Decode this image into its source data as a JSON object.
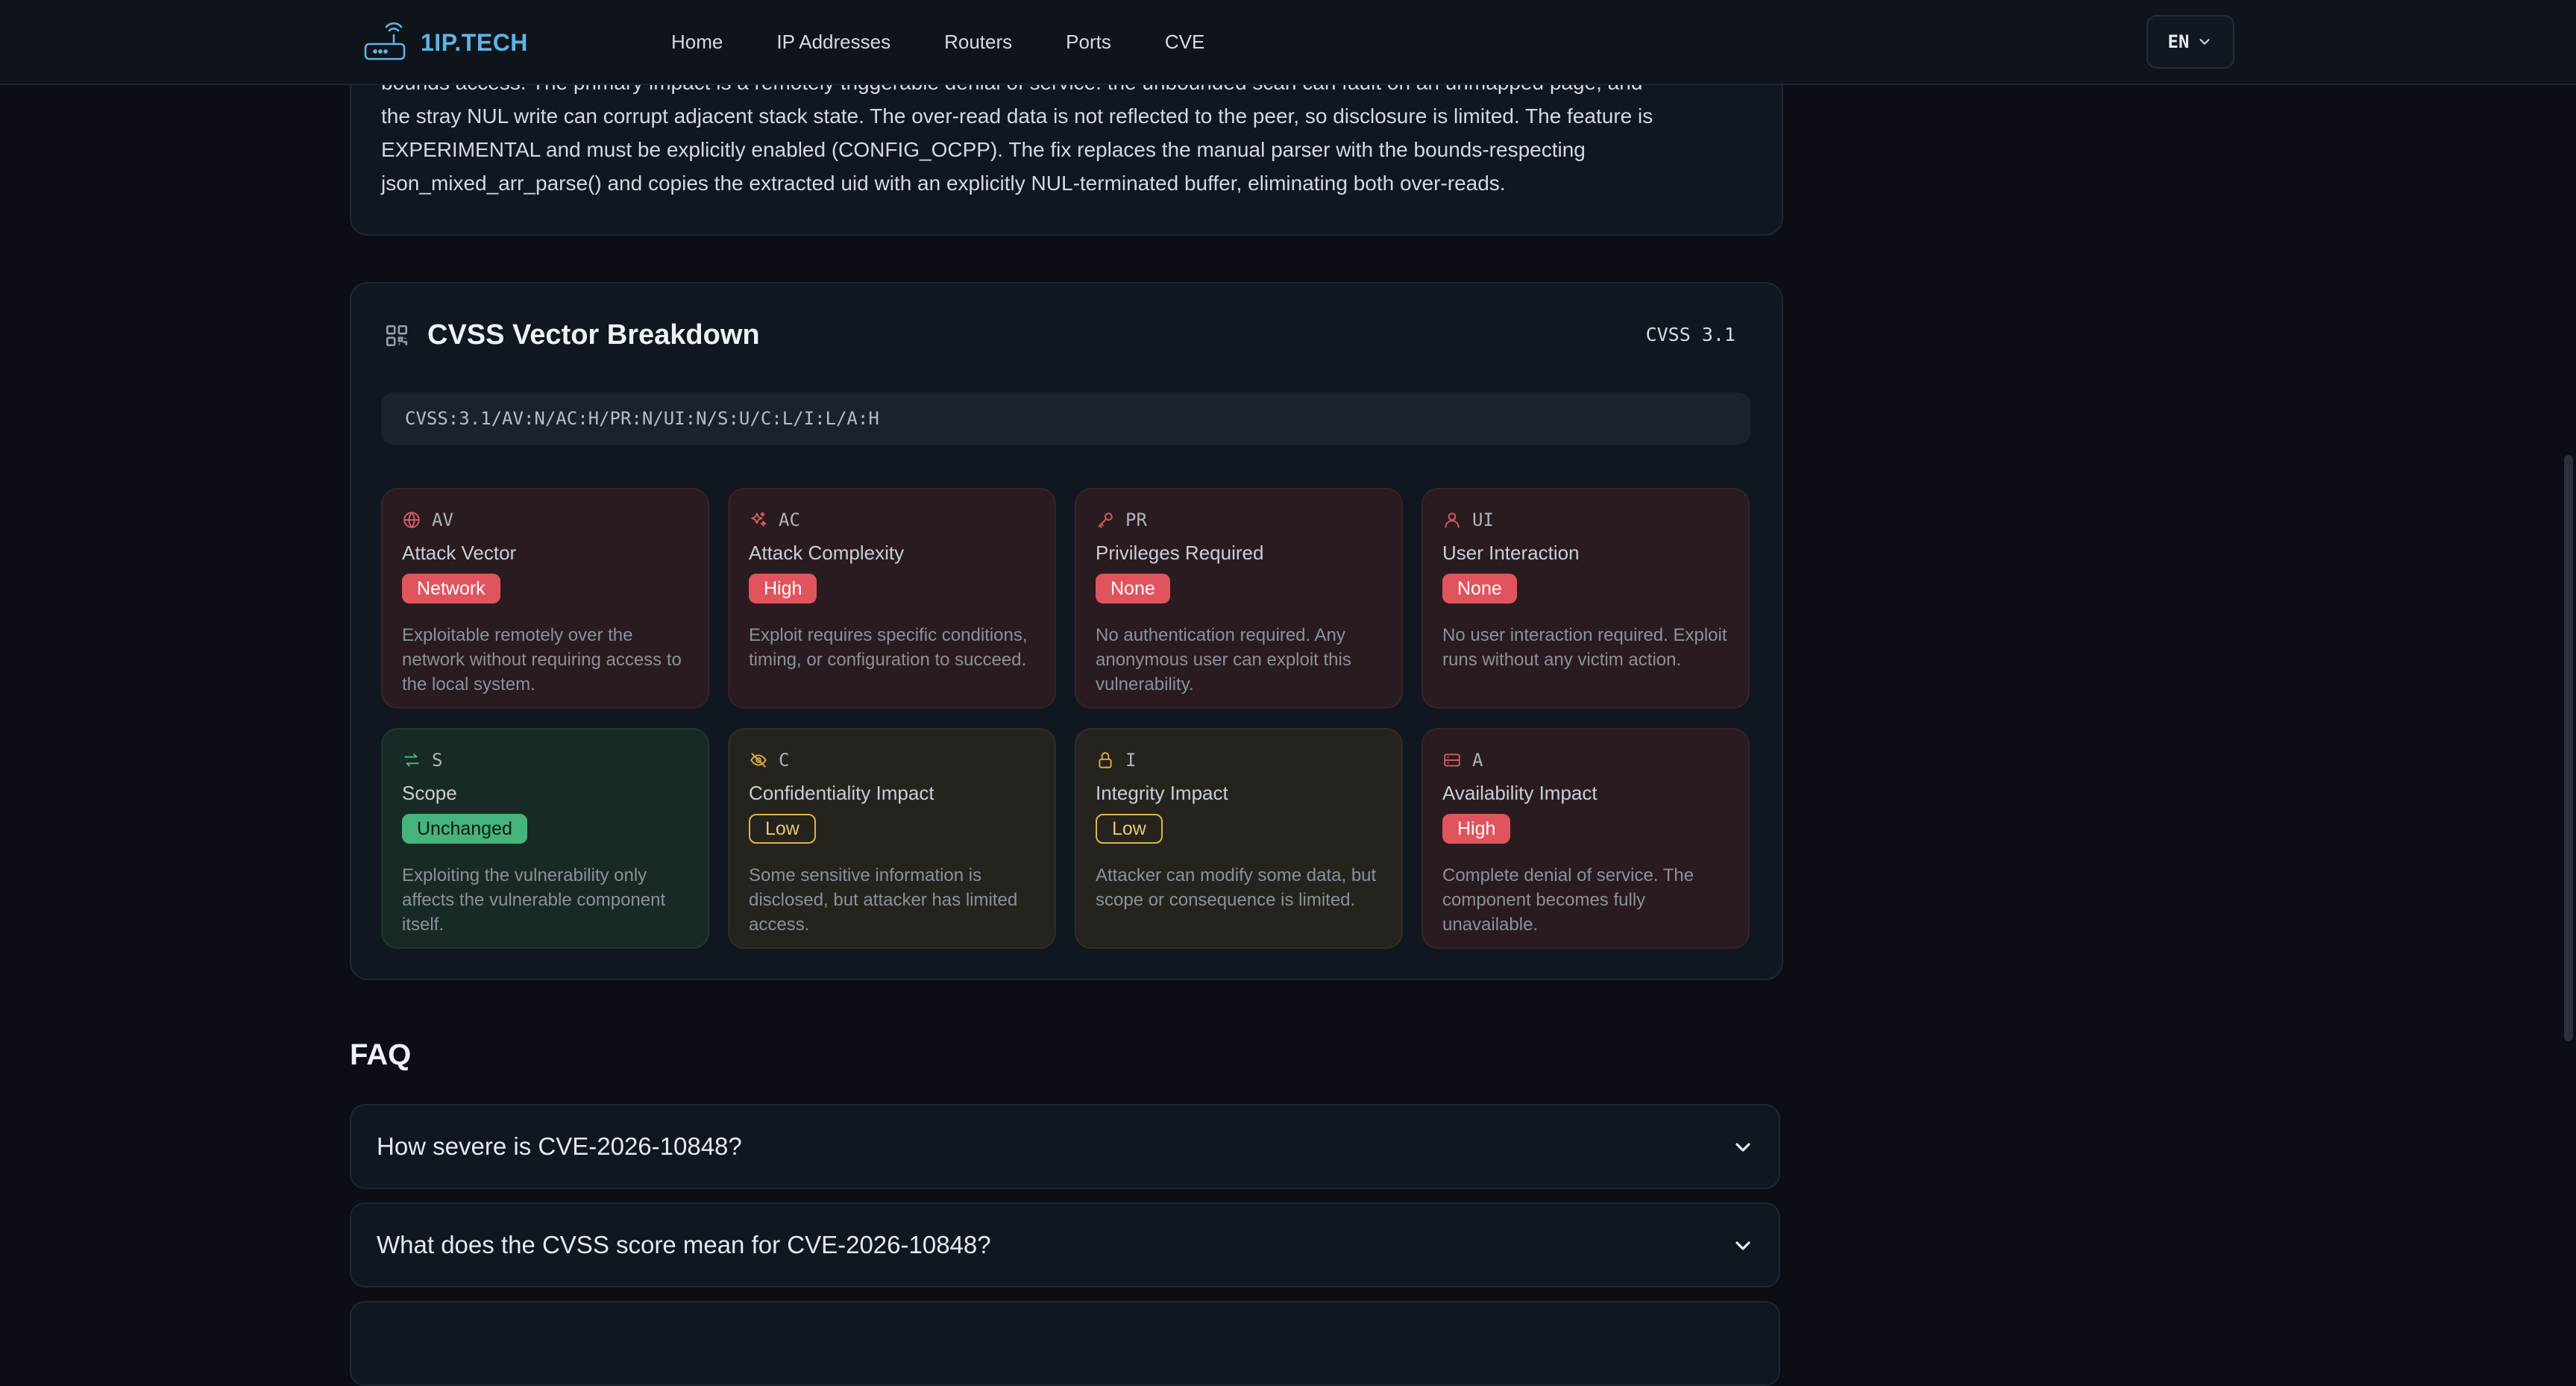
{
  "brand": {
    "name": "1IP.TECH"
  },
  "nav": {
    "links": [
      "Home",
      "IP Addresses",
      "Routers",
      "Ports",
      "CVE"
    ]
  },
  "lang": {
    "label": "EN"
  },
  "summary": {
    "lines": [
      "bounds access. The primary impact is a remotely triggerable denial of service: the unbounded scan can fault on an unmapped page, and",
      "the stray NUL write can corrupt adjacent stack state. The over-read data is not reflected to the peer, so disclosure is limited. The feature is",
      "EXPERIMENTAL and must be explicitly enabled (CONFIG_OCPP). The fix replaces the manual parser with the bounds-respecting",
      "json_mixed_arr_parse() and copies the extracted uid with an explicitly NUL-terminated buffer, eliminating both over-reads."
    ]
  },
  "cvss": {
    "title": "CVSS Vector Breakdown",
    "version": "CVSS 3.1",
    "vector": "CVSS:3.1/AV:N/AC:H/PR:N/UI:N/S:U/C:L/I:L/A:H",
    "metrics": [
      {
        "code": "AV",
        "name": "Attack Vector",
        "value": "Network",
        "desc": "Exploitable remotely over the network without requiring access to the local system.",
        "severity": "red",
        "icon": "globe-icon"
      },
      {
        "code": "AC",
        "name": "Attack Complexity",
        "value": "High",
        "desc": "Exploit requires specific conditions, timing, or configuration to succeed.",
        "severity": "red",
        "icon": "sparkles-icon"
      },
      {
        "code": "PR",
        "name": "Privileges Required",
        "value": "None",
        "desc": "No authentication required. Any anonymous user can exploit this vulnerability.",
        "severity": "red",
        "icon": "key-icon"
      },
      {
        "code": "UI",
        "name": "User Interaction",
        "value": "None",
        "desc": "No user interaction required. Exploit runs without any victim action.",
        "severity": "red",
        "icon": "user-icon"
      },
      {
        "code": "S",
        "name": "Scope",
        "value": "Unchanged",
        "desc": "Exploiting the vulnerability only affects the vulnerable component itself.",
        "severity": "green",
        "icon": "arrows-swap-icon"
      },
      {
        "code": "C",
        "name": "Confidentiality Impact",
        "value": "Low",
        "desc": "Some sensitive information is disclosed, but attacker has limited access.",
        "severity": "yellow",
        "icon": "eye-off-icon"
      },
      {
        "code": "I",
        "name": "Integrity Impact",
        "value": "Low",
        "desc": "Attacker can modify some data, but scope or consequence is limited.",
        "severity": "yellow",
        "icon": "lock-icon"
      },
      {
        "code": "A",
        "name": "Availability Impact",
        "value": "High",
        "desc": "Complete denial of service. The component becomes fully unavailable.",
        "severity": "red",
        "icon": "server-icon"
      }
    ]
  },
  "faq": {
    "heading": "FAQ",
    "items": [
      "How severe is CVE-2026-10848?",
      "What does the CVSS score mean for CVE-2026-10848?"
    ]
  },
  "colors": {
    "background": "#0b0f15",
    "card": "#111720",
    "accent": "#5fb4e6",
    "badge_red": "#e0545e",
    "badge_green": "#46b37a",
    "badge_yellow": "#e0b44c"
  }
}
